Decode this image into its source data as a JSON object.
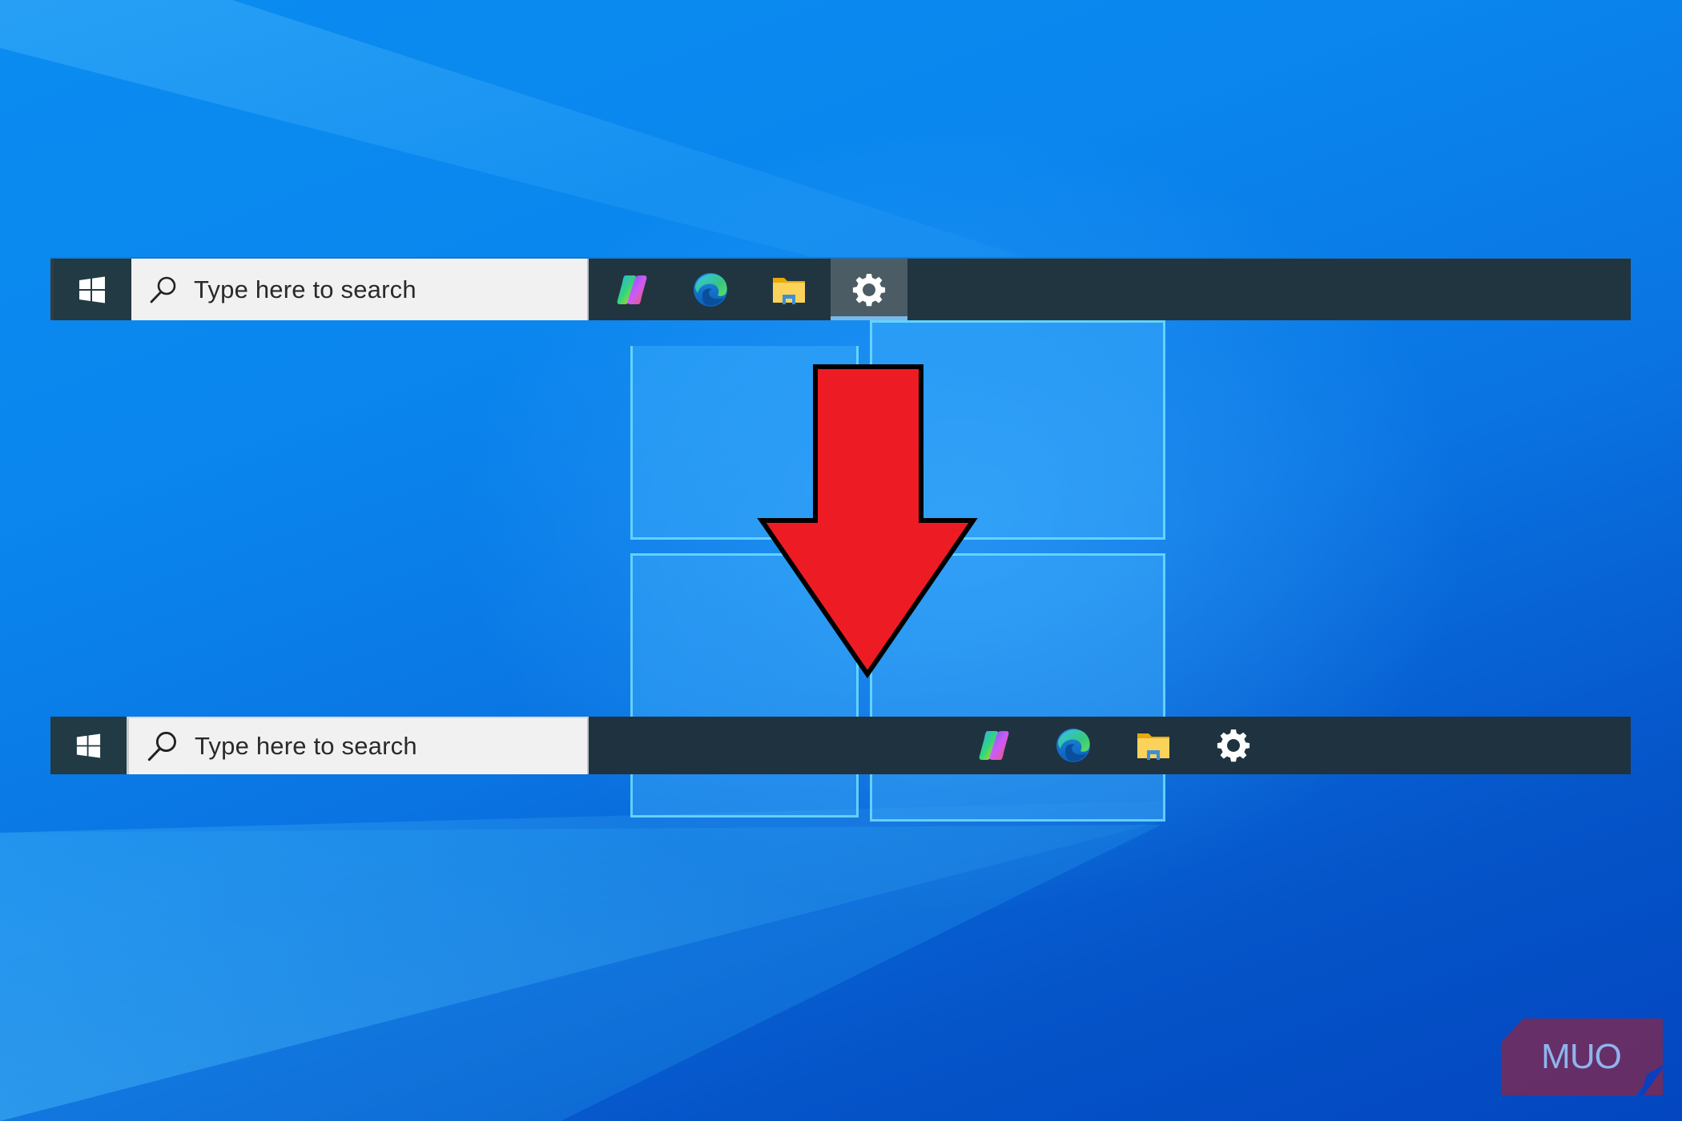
{
  "scene": {
    "description": "Windows 10 taskbar icon alignment: left-aligned (before) to centered (after)",
    "wallpaper": "Windows 10 default blue wallpaper"
  },
  "colors": {
    "taskbar_bg": "#213540",
    "search_bg": "#f1f1f1",
    "active_app_bg": "#4c5c64",
    "active_indicator": "#79b8ea",
    "arrow_fill": "#ed1c24",
    "arrow_stroke": "#000000",
    "watermark_bg": "#6b2d62",
    "watermark_text": "#8fb4ee"
  },
  "taskbars": [
    {
      "id": "before",
      "alignment": "left",
      "start_button": {
        "icon": "windows-logo-icon",
        "label": "Start"
      },
      "search": {
        "icon": "search-icon",
        "placeholder": "Type here to search"
      },
      "apps": [
        {
          "name": "Copilot",
          "icon": "copilot-icon",
          "active": false
        },
        {
          "name": "Microsoft Edge",
          "icon": "edge-icon",
          "active": false
        },
        {
          "name": "File Explorer",
          "icon": "file-explorer-icon",
          "active": false
        },
        {
          "name": "Settings",
          "icon": "gear-icon",
          "active": true
        }
      ]
    },
    {
      "id": "after",
      "alignment": "center",
      "start_button": {
        "icon": "windows-logo-icon",
        "label": "Start"
      },
      "search": {
        "icon": "search-icon",
        "placeholder": "Type here to search"
      },
      "apps": [
        {
          "name": "Copilot",
          "icon": "copilot-icon",
          "active": false
        },
        {
          "name": "Microsoft Edge",
          "icon": "edge-icon",
          "active": false
        },
        {
          "name": "File Explorer",
          "icon": "file-explorer-icon",
          "active": false
        },
        {
          "name": "Settings",
          "icon": "gear-icon",
          "active": false
        }
      ]
    }
  ],
  "annotation": {
    "shape": "down-arrow",
    "meaning": "before to after"
  },
  "watermark": {
    "text": "MUO"
  }
}
